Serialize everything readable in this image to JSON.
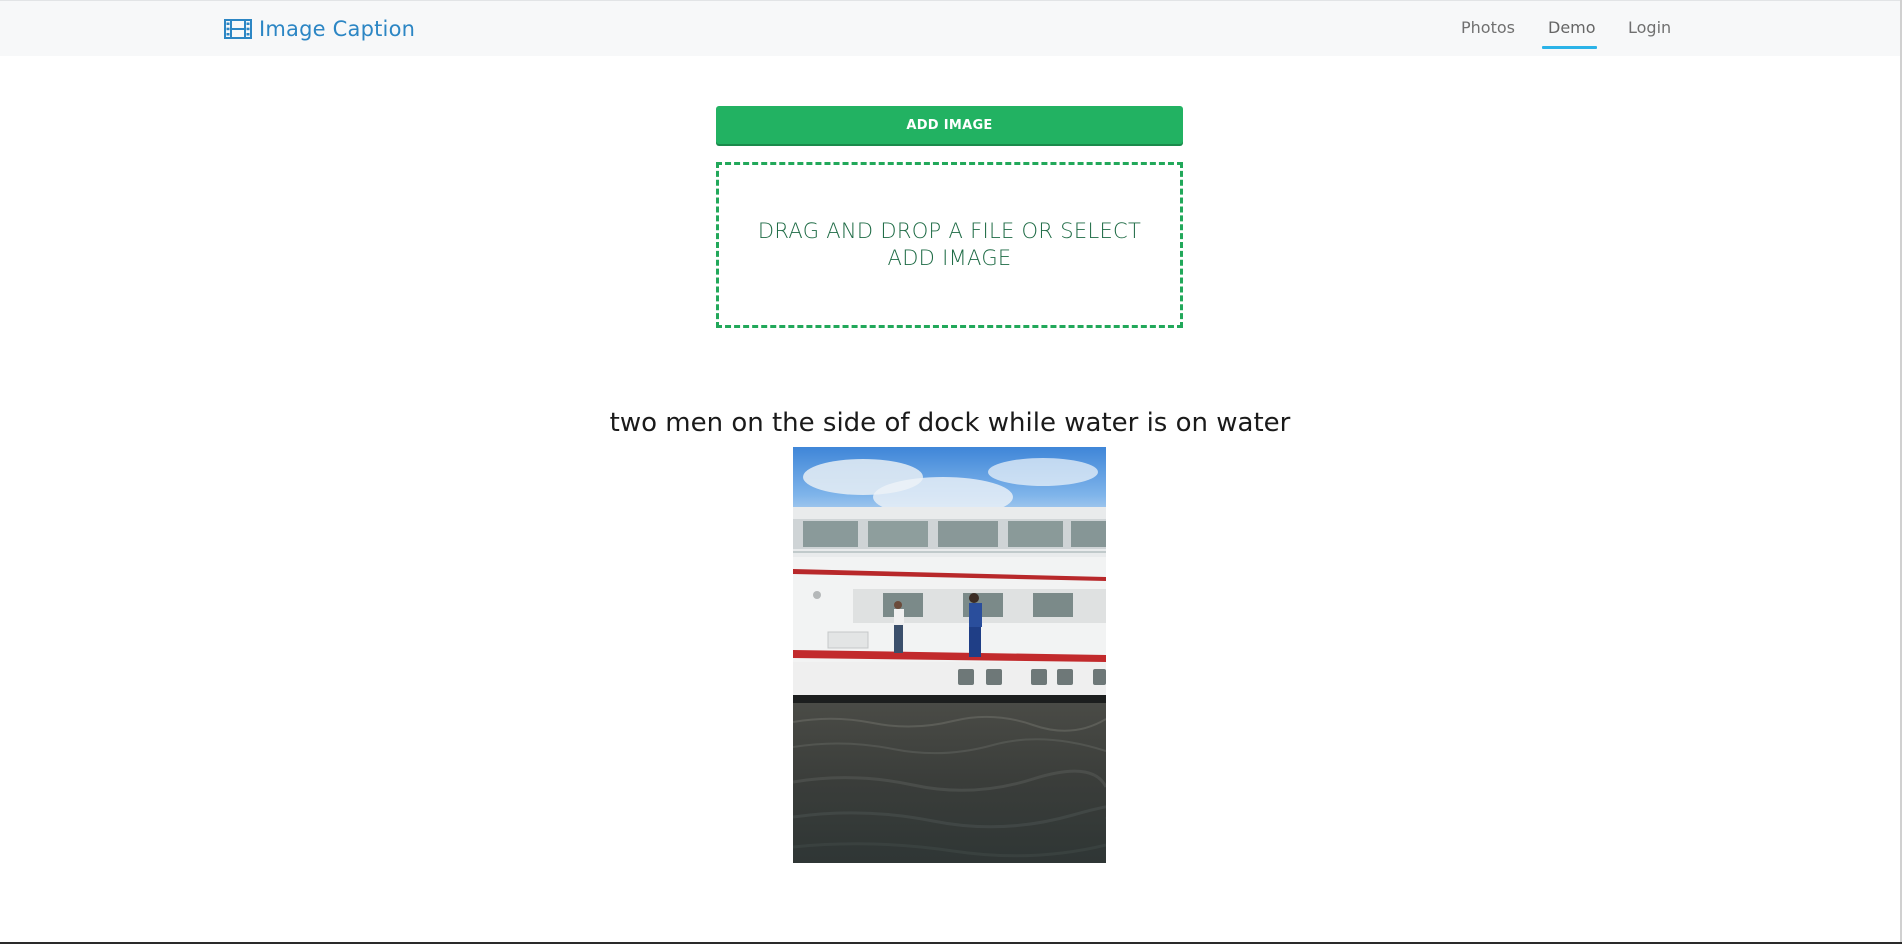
{
  "navbar": {
    "brand": {
      "icon": "film-icon",
      "title": "Image Caption"
    },
    "items": [
      {
        "label": "Photos",
        "active": false
      },
      {
        "label": "Demo",
        "active": true
      },
      {
        "label": "Login",
        "active": false
      }
    ],
    "accent_color": "#2bb3e8",
    "brand_color": "#2c86c4"
  },
  "upload": {
    "button_label": "ADD IMAGE",
    "dropzone_text": "DRAG AND DROP A FILE OR SELECT ADD IMAGE",
    "color": "#22b262"
  },
  "result": {
    "caption": "two men on the side of dock while water is on water"
  }
}
